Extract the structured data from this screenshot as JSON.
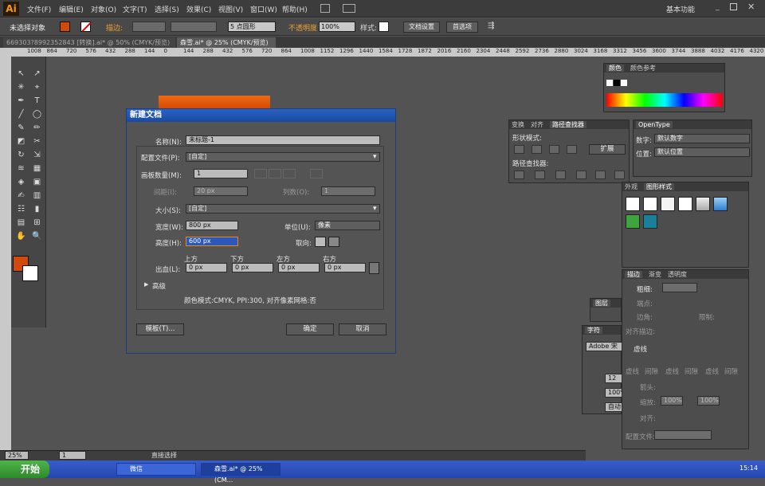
{
  "menubar": {
    "logo": "Ai",
    "items": [
      "文件(F)",
      "编辑(E)",
      "对象(O)",
      "文字(T)",
      "选择(S)",
      "效果(C)",
      "视图(V)",
      "窗口(W)",
      "帮助(H)"
    ],
    "workspace": "基本功能"
  },
  "control": {
    "selection": "未选择对象",
    "stroke_label": "描边:",
    "brush": "5 点圆形",
    "opacity_label": "不透明度",
    "opacity": "100%",
    "style_label": "样式:",
    "doc_setup": "文档设置",
    "prefs": "首选项"
  },
  "tabs": [
    {
      "label": "669303?8992352843 [转换].ai* @ 50% (CMYK/预览)"
    },
    {
      "label": "森雪.ai* @ 25% (CMYK/预览)"
    }
  ],
  "ruler": [
    "1008",
    "864",
    "720",
    "576",
    "432",
    "288",
    "144",
    "0",
    "144",
    "288",
    "432",
    "576",
    "720",
    "864",
    "1008",
    "1152",
    "1296",
    "1440",
    "1584",
    "1728",
    "1872",
    "2016",
    "2160",
    "2304",
    "2448",
    "2592",
    "2736",
    "2880",
    "3024",
    "3168",
    "3312",
    "3456",
    "3600",
    "3744",
    "3888",
    "4032",
    "4176",
    "4320"
  ],
  "dialog": {
    "title": "新建文档",
    "name_label": "名称(N):",
    "name": "未标题-1",
    "profile_label": "配置文件(P):",
    "profile": "[自定]",
    "artboards_label": "画板数量(M):",
    "artboards": "1",
    "spacing_label": "间距(I):",
    "spacing": "20 px",
    "columns_label": "列数(O):",
    "columns": "1",
    "size_label": "大小(S):",
    "size": "[自定]",
    "width_label": "宽度(W):",
    "width": "800 px",
    "units_label": "单位(U):",
    "units": "像素",
    "height_label": "高度(H):",
    "height": "600 px",
    "orient_label": "取向:",
    "bleed_label": "出血(L):",
    "bleed_top_label": "上方",
    "bleed_bottom_label": "下方",
    "bleed_left_label": "左方",
    "bleed_right_label": "右方",
    "bleed_top": "0 px",
    "bleed_bottom": "0 px",
    "bleed_left": "0 px",
    "bleed_right": "0 px",
    "advanced": "高级",
    "info": "颜色模式:CMYK, PPI:300, 对齐像素网格:否",
    "templates": "模板(T)...",
    "ok": "确定",
    "cancel": "取消"
  },
  "panels": {
    "color": {
      "tab1": "颜色",
      "tab2": "颜色参考"
    },
    "pathfinder": {
      "tab1": "变换",
      "tab2": "对齐",
      "tab3": "路径查找器",
      "shape_modes": "形状模式:",
      "expand": "扩展",
      "pathfinders": "路径查找器:"
    },
    "opentype": {
      "tab": "OpenType",
      "figure_label": "数字:",
      "figure": "默认数字",
      "position_label": "位置:",
      "position": "默认位置"
    },
    "appearance": {
      "tab1": "外观",
      "tab2": "图形样式"
    },
    "stroke": {
      "tab1": "描边",
      "tab2": "渐变",
      "tab3": "透明度",
      "weight_label": "粗细:",
      "cap_label": "端点:",
      "corner_label": "边角:",
      "limit_label": "限制:",
      "align_label": "对齐描边:",
      "dashed": "虚线",
      "dash_labels": [
        "虚线",
        "间隙",
        "虚线",
        "间隙",
        "虚线",
        "间隙"
      ],
      "arrow_label": "箭头:",
      "scale_label": "缩放:",
      "scale1": "100%",
      "scale2": "100%",
      "align2_label": "对齐:",
      "profile_label": "配置文件:"
    },
    "layers": {
      "tab1": "图层",
      "tab2": "画板"
    },
    "character": {
      "tab1": "字符",
      "tab2": "段落",
      "font": "Adobe 宋体",
      "size": "12 p",
      "leading": "100%",
      "tracking": "自动"
    }
  },
  "status": {
    "zoom": "25%",
    "page": "1",
    "tool": "直接选择"
  },
  "taskbar": {
    "start": "开始",
    "items": [
      "微信",
      "森雪.ai* @ 25% (CM..."
    ],
    "time": "15:14"
  }
}
